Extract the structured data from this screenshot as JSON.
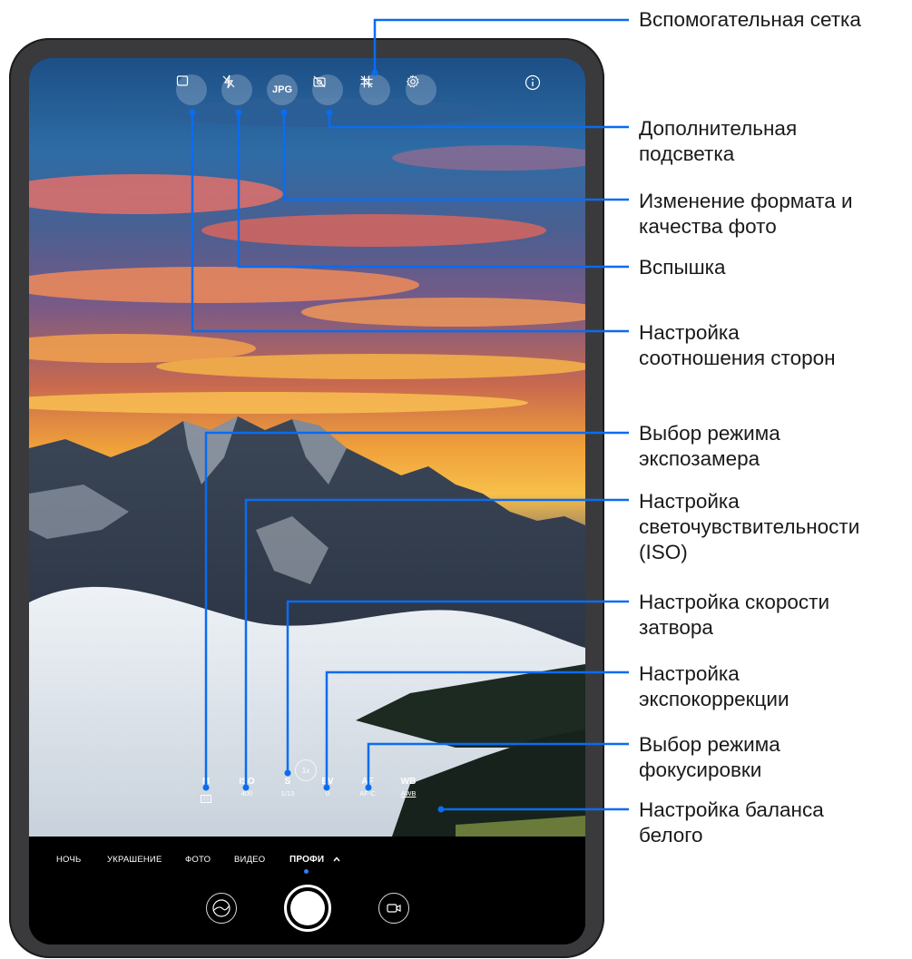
{
  "top_bar": {
    "aspect_icon_text": "4:3",
    "format_label": "JPG",
    "icons": [
      "aspect-ratio-icon",
      "flash-off-icon",
      "format-icon",
      "fill-light-off-icon",
      "grid-icon",
      "settings-icon",
      "info-icon"
    ]
  },
  "pro_params": [
    {
      "id": "metering",
      "label": "M",
      "value": "[·]"
    },
    {
      "id": "iso",
      "label": "ISO",
      "value": "400"
    },
    {
      "id": "shutter",
      "label": "S",
      "value": "1/13"
    },
    {
      "id": "ev",
      "label": "EV",
      "value": "0"
    },
    {
      "id": "af",
      "label": "AF",
      "value": "AF-C"
    },
    {
      "id": "wb",
      "label": "WB",
      "value": "AWB"
    }
  ],
  "zoom_label": "1x",
  "modes": [
    "НОЧЬ",
    "УКРАШЕНИЕ",
    "ФОТО",
    "ВИДЕО",
    "ПРОФИ"
  ],
  "active_mode": "ПРОФИ",
  "callouts": {
    "grid": [
      "Вспомогательная сетка"
    ],
    "fill_light": [
      "Дополнительная",
      "подсветка"
    ],
    "format": [
      "Изменение формата и",
      "качества фото"
    ],
    "flash": [
      "Вспышка"
    ],
    "aspect": [
      "Настройка",
      "соотношения сторон"
    ],
    "metering": [
      "Выбор режима",
      "экспозамера"
    ],
    "iso": [
      "Настройка",
      "светочувствительности",
      "(ISO)"
    ],
    "shutter": [
      "Настройка скорости",
      "затвора"
    ],
    "ev": [
      "Настройка",
      "экспокоррекции"
    ],
    "af": [
      "Выбор режима",
      "фокусировки"
    ],
    "wb": [
      "Настройка баланса",
      "белого"
    ]
  },
  "colors": {
    "callout_line": "#0a6cf0",
    "active_dot": "#2f7df6",
    "frame": "#3a3a3c"
  }
}
